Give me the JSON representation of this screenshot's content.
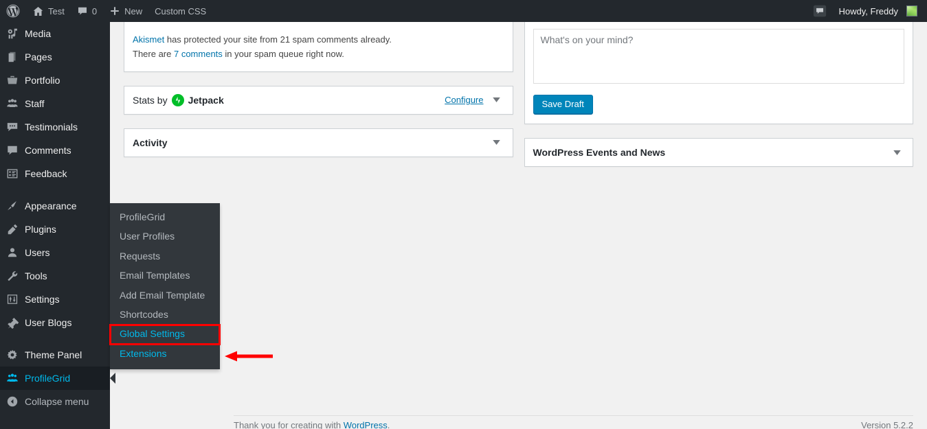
{
  "adminbar": {
    "wp_logo_icon": "wordpress-logo-icon",
    "site_icon": "home-icon",
    "site_name": "Test",
    "comments_icon": "comment-bubble-icon",
    "comments_count": "0",
    "new_icon": "plus-icon",
    "new_label": "New",
    "custom_css_label": "Custom CSS",
    "notice_icon": "comment-bubble-icon",
    "howdy_label": "Howdy, Freddy",
    "avatar": "user-avatar"
  },
  "sidebar": {
    "items": [
      {
        "label": "Media",
        "icon": "media-icon",
        "state": "normal"
      },
      {
        "label": "Pages",
        "icon": "pages-icon",
        "state": "normal"
      },
      {
        "label": "Portfolio",
        "icon": "portfolio-icon",
        "state": "normal"
      },
      {
        "label": "Staff",
        "icon": "staff-icon",
        "state": "normal"
      },
      {
        "label": "Testimonials",
        "icon": "testimonials-icon",
        "state": "normal"
      },
      {
        "label": "Comments",
        "icon": "comments-icon",
        "state": "normal"
      },
      {
        "label": "Feedback",
        "icon": "feedback-icon",
        "state": "normal"
      },
      {
        "label": "Appearance",
        "icon": "appearance-icon",
        "state": "normal"
      },
      {
        "label": "Plugins",
        "icon": "plugins-icon",
        "state": "normal"
      },
      {
        "label": "Users",
        "icon": "users-icon",
        "state": "normal"
      },
      {
        "label": "Tools",
        "icon": "tools-icon",
        "state": "normal"
      },
      {
        "label": "Settings",
        "icon": "settings-icon",
        "state": "normal"
      },
      {
        "label": "User Blogs",
        "icon": "user-blogs-icon",
        "state": "normal"
      },
      {
        "label": "Theme Panel",
        "icon": "theme-panel-icon",
        "state": "normal"
      },
      {
        "label": "ProfileGrid",
        "icon": "profilegrid-icon",
        "state": "current"
      },
      {
        "label": "Collapse menu",
        "icon": "collapse-icon",
        "state": "collapse"
      }
    ]
  },
  "flyout": {
    "items": [
      {
        "label": "ProfileGrid",
        "style": "normal"
      },
      {
        "label": "User Profiles",
        "style": "normal"
      },
      {
        "label": "Requests",
        "style": "normal"
      },
      {
        "label": "Email Templates",
        "style": "normal"
      },
      {
        "label": "Add Email Template",
        "style": "normal"
      },
      {
        "label": "Shortcodes",
        "style": "normal"
      },
      {
        "label": "Global Settings",
        "style": "highlight"
      },
      {
        "label": "Extensions",
        "style": "link"
      }
    ]
  },
  "annotation": {
    "arrow_color": "#ff0000",
    "highlight_box_color": "#ff0000",
    "points_to": "Global Settings"
  },
  "main": {
    "akismet": {
      "line1_link": "Akismet",
      "line1_text": " has protected your site from 21 spam comments already.",
      "line2_pre": "There are ",
      "line2_link": "7 comments",
      "line2_post": " in your spam queue right now."
    },
    "stats": {
      "title_prefix": "Stats by",
      "logo_icon": "jetpack-logo-icon",
      "brand": "Jetpack",
      "configure_label": "Configure",
      "toggle_icon": "chevron-down-icon"
    },
    "activity": {
      "title": "Activity",
      "toggle_icon": "chevron-down-icon"
    },
    "quickdraft": {
      "content_placeholder": "What's on your mind?",
      "content_value": "",
      "save_label": "Save Draft"
    },
    "events": {
      "title": "WordPress Events and News",
      "toggle_icon": "chevron-down-icon"
    }
  },
  "footer": {
    "thanks_pre": "Thank you for creating with ",
    "thanks_link": "WordPress",
    "thanks_post": ".",
    "version": "Version 5.2.2"
  },
  "colors": {
    "admin_bar_bg": "#23282d",
    "sidebar_bg": "#23282d",
    "submenu_bg": "#32373c",
    "accent_blue": "#00b9eb",
    "link_blue": "#0073aa",
    "button_blue": "#0085ba",
    "content_bg": "#f1f1f1",
    "annotation_red": "#ff0000",
    "jetpack_green": "#00be28"
  }
}
